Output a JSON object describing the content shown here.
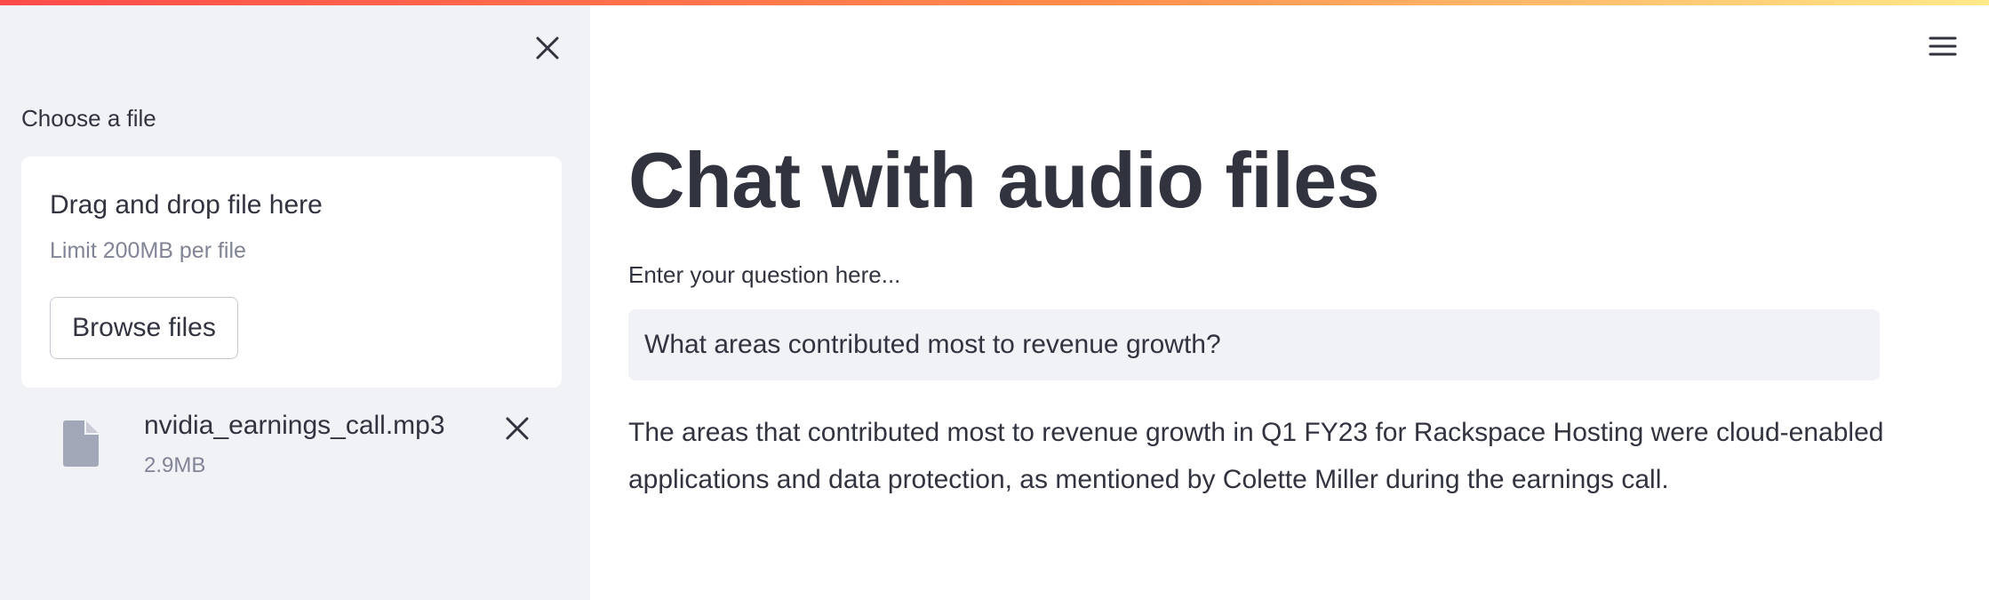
{
  "sidebar": {
    "uploader_label": "Choose a file",
    "dropzone": {
      "title": "Drag and drop file here",
      "limit": "Limit 200MB per file",
      "browse_label": "Browse files"
    },
    "file": {
      "name": "nvidia_earnings_call.mp3",
      "size": "2.9MB",
      "icon": "file-icon"
    },
    "icons": {
      "close": "close-icon",
      "remove": "close-icon"
    }
  },
  "main": {
    "title": "Chat with audio files",
    "question_label": "Enter your question here...",
    "question_value": "What areas contributed most to revenue growth?",
    "answer": "The areas that contributed most to revenue growth in Q1 FY23 for Rackspace Hosting were cloud-enabled applications and data protection, as mentioned by Colette Miller during the earnings call.",
    "menu_icon": "hamburger-menu-icon"
  },
  "colors": {
    "sidebar_bg": "#f0f2f6",
    "text": "#31333f",
    "muted_text": "#808495",
    "accent_gradient": [
      "#ff4b4b",
      "#ff8c4b",
      "#ffe98a"
    ]
  }
}
